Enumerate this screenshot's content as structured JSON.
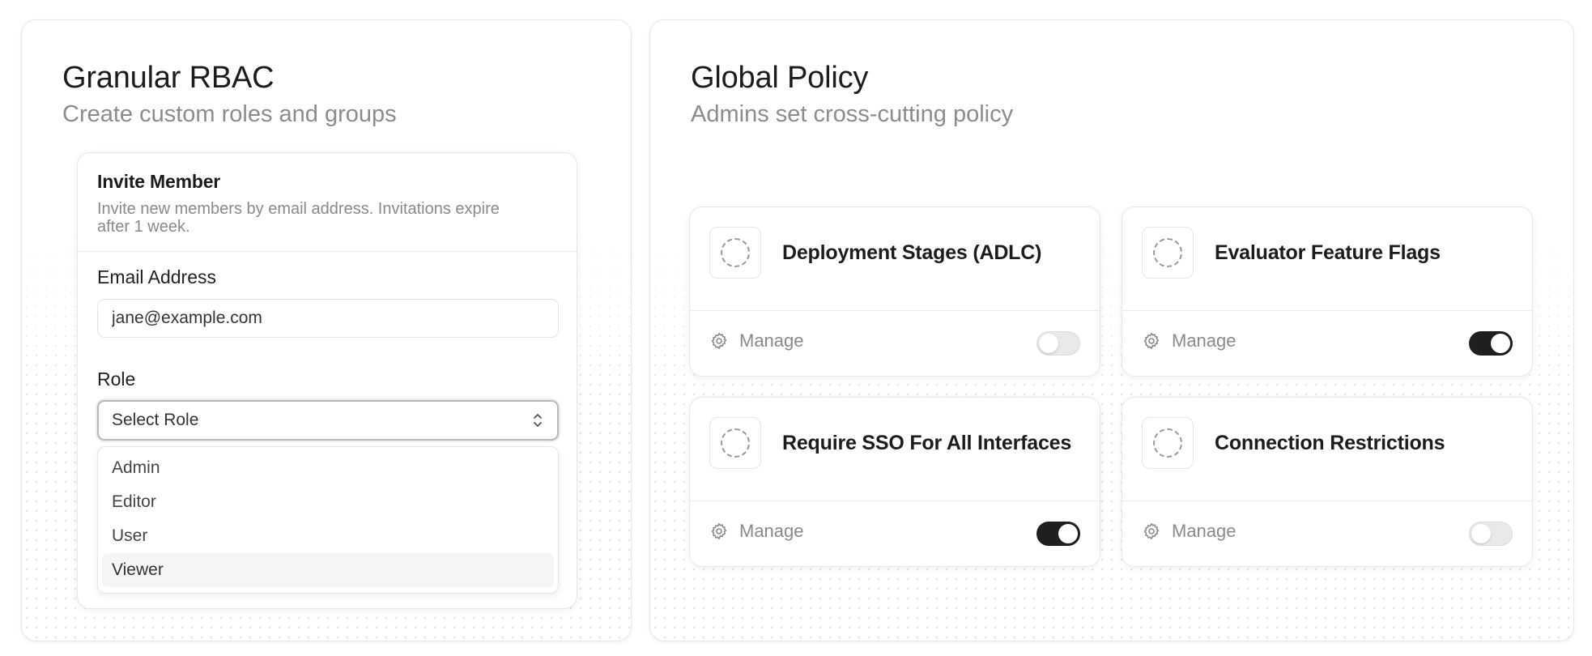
{
  "rbac": {
    "title": "Granular RBAC",
    "subtitle": "Create custom roles and groups",
    "invite": {
      "title": "Invite Member",
      "description": "Invite new members by email address. Invitations expire after 1 week.",
      "email_label": "Email Address",
      "email_value": "jane@example.com",
      "role_label": "Role",
      "role_select_label": "Select Role",
      "role_options": [
        "Admin",
        "Editor",
        "User",
        "Viewer"
      ],
      "highlighted_option": "Viewer"
    }
  },
  "policy": {
    "title": "Global Policy",
    "subtitle": "Admins set cross-cutting policy",
    "cards": [
      {
        "title": "Deployment Stages (ADLC)",
        "manage_label": "Manage",
        "enabled": false,
        "icon": "dashed-circle-icon"
      },
      {
        "title": "Evaluator Feature Flags",
        "manage_label": "Manage",
        "enabled": true,
        "icon": "dashed-circle-icon"
      },
      {
        "title": "Require SSO For All Interfaces",
        "manage_label": "Manage",
        "enabled": true,
        "icon": "dashed-circle-icon"
      },
      {
        "title": "Connection Restrictions",
        "manage_label": "Manage",
        "enabled": false,
        "icon": "dashed-circle-icon"
      }
    ]
  },
  "colors": {
    "toggle_on": "#1f1f1f",
    "toggle_off": "#e9e9e9",
    "muted_text": "#8a8a8a"
  }
}
